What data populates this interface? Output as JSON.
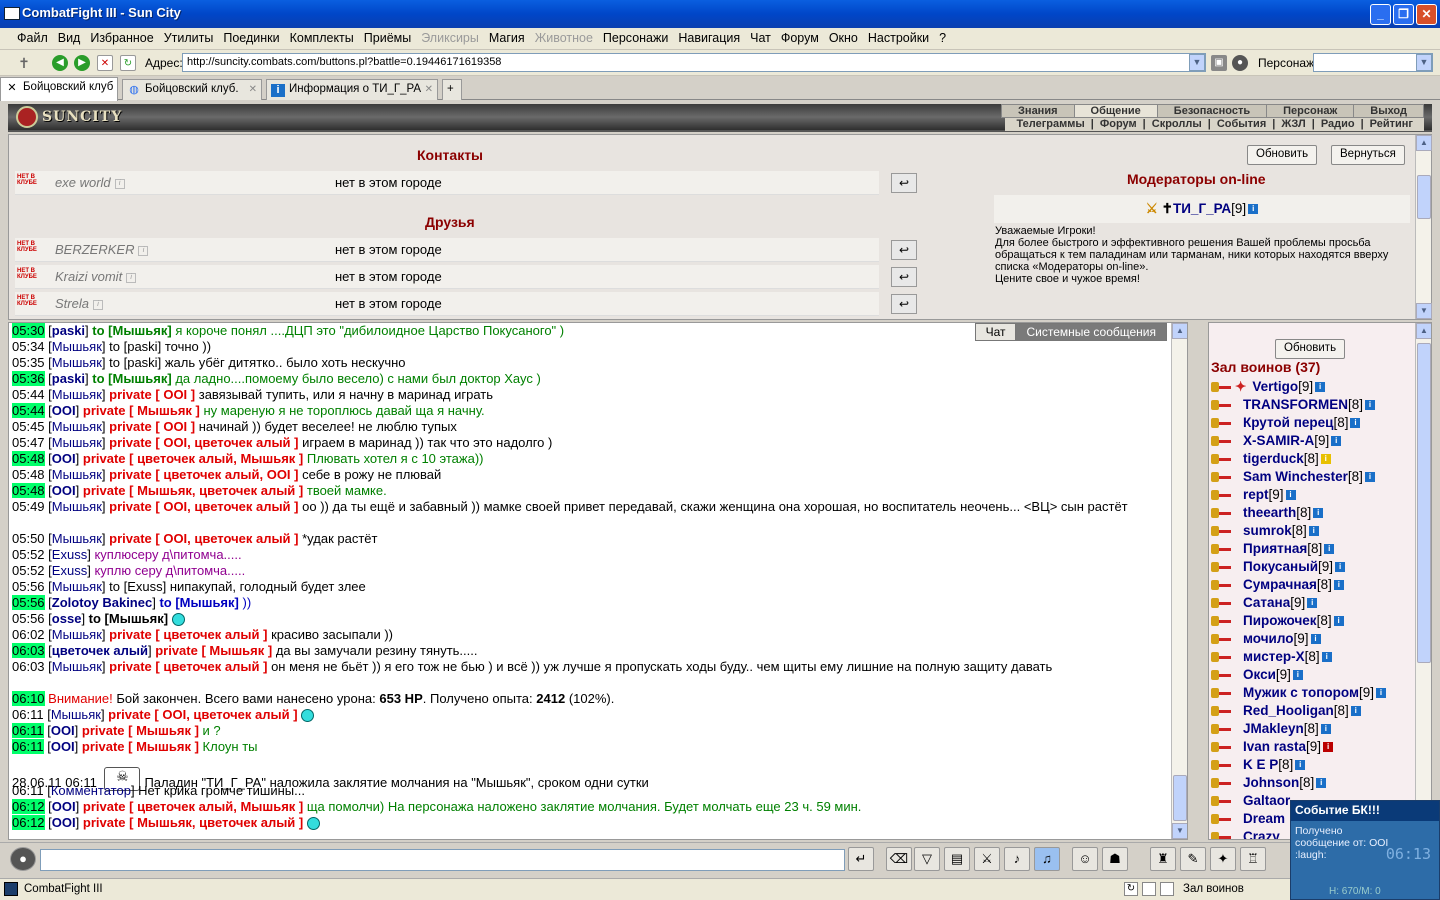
{
  "window": {
    "title": "CombatFight III - Sun City"
  },
  "menu": [
    "Файл",
    "Вид",
    "Избранное",
    "Утилиты",
    "Поединки",
    "Комплекты",
    "Приёмы",
    "Эликсиры",
    "Магия",
    "Животное",
    "Персонажи",
    "Навигация",
    "Чат",
    "Форум",
    "Окно",
    "Настройки",
    "?"
  ],
  "address": {
    "label": "Адрес:",
    "url": "http://suncity.combats.com/buttons.pl?battle=0.19446171619358",
    "persona_label": "Персонаж:"
  },
  "tabs": [
    "Бойцовский клуб",
    "Бойцовский клуб.",
    "Информация о ТИ_Г_РА"
  ],
  "topnav": {
    "main": [
      "Знания",
      "Общение",
      "Безопасность",
      "Персонаж",
      "Выход"
    ],
    "sub": [
      "Телеграммы",
      "Форум",
      "Скроллы",
      "События",
      "ЖЗЛ",
      "Радио",
      "Рейтинг"
    ]
  },
  "logo": "SUNCITY",
  "contacts": {
    "title": "Контакты",
    "friends_title": "Друзья",
    "not_in_club": "НЕТ В КЛУБЕ",
    "contacts": [
      {
        "name": "exe world",
        "status": "нет в этом городе"
      }
    ],
    "friends": [
      {
        "name": "BERZERKER",
        "status": "нет в этом городе"
      },
      {
        "name": "Kraizi vomit",
        "status": "нет в этом городе"
      },
      {
        "name": "Strela",
        "status": "нет в этом городе"
      }
    ],
    "refresh": "Обновить",
    "back": "Вернуться",
    "moderators_title": "Модераторы on-line",
    "moderator": "ТИ_Г_РА",
    "moderator_level": "[9]",
    "moderator_text": "Уважаемые Игроки!\nДля более быстрого и эффективного решения Вашей проблемы просьба обращаться к тем паладинам или тарманам, ники которых находятся вверху списка «Модераторы on-line».\nЦените свое и чужое время!"
  },
  "chat_tabs": [
    "Чат",
    "Системные сообщения"
  ],
  "chat": [
    {
      "t": "05:30",
      "h": true,
      "who": "paski",
      "type": "to",
      "tgt": "Мышьяк",
      "msg": "я короче понял ....ДЦП это \"дибилоидное Царство Покусаного\" )",
      "c": "tg"
    },
    {
      "t": "05:34",
      "who": "Мышьяк",
      "type": "to",
      "tgt": "paski",
      "msg": "точно ))",
      "c": ""
    },
    {
      "t": "05:35",
      "who": "Мышьяк",
      "type": "to",
      "tgt": "paski",
      "msg": "жаль убёг дитятко.. было хоть нескучно",
      "c": ""
    },
    {
      "t": "05:36",
      "h": true,
      "who": "paski",
      "type": "to",
      "tgt": "Мышьяк",
      "msg": "да ладно....помоему было весело) с нами был доктор Хаус )",
      "c": "tg"
    },
    {
      "t": "05:44",
      "who": "Мышьяк",
      "type": "private",
      "tgt": "OOI",
      "msg": "завязывай тупить, или я начну в маринад играть",
      "c": ""
    },
    {
      "t": "05:44",
      "h": true,
      "who": "OOI",
      "type": "private",
      "tgt": "Мышьяк",
      "msg": "ну мареную я не тороплюсь давай ща я начну.",
      "c": "tg"
    },
    {
      "t": "05:45",
      "who": "Мышьяк",
      "type": "private",
      "tgt": "OOI",
      "msg": "начинай )) будет веселее! не люблю тупых",
      "c": ""
    },
    {
      "t": "05:47",
      "who": "Мышьяк",
      "type": "private",
      "tgt": "OOI, цветочек алый",
      "msg": "играем в маринад )) так что это надолго )",
      "c": ""
    },
    {
      "t": "05:48",
      "h": true,
      "who": "OOI",
      "type": "private",
      "tgt": "цветочек алый, Мышьяк",
      "msg": "Плювать хотел я с 10 этажа))",
      "c": "tg"
    },
    {
      "t": "05:48",
      "who": "Мышьяк",
      "type": "private",
      "tgt": "цветочек алый, OOI",
      "msg": "себе в рожу не плювай",
      "c": ""
    },
    {
      "t": "05:48",
      "h": true,
      "who": "OOI",
      "type": "private",
      "tgt": "Мышьяк, цветочек алый",
      "msg": "твоей мамке.",
      "c": "tg"
    },
    {
      "t": "05:49",
      "who": "Мышьяк",
      "type": "private",
      "tgt": "OOI, цветочек алый",
      "msg": "оо )) да ты ещё и забавный )) мамке своей привет передавай, скажи женщина она хорошая, но воспитатель неочень... <ВЦ> сын растёт",
      "c": "",
      "wrap": true
    },
    {
      "t": "05:50",
      "who": "Мышьяк",
      "type": "private",
      "tgt": "OOI, цветочек алый",
      "msg": "*удак растёт",
      "c": ""
    },
    {
      "t": "05:52",
      "who": "Exuss",
      "type": "plain",
      "msg": "куплюсеру д\\питомча.....",
      "c": "pur"
    },
    {
      "t": "05:52",
      "who": "Exuss",
      "type": "plain",
      "msg": "куплю серу д\\питомча.....",
      "c": "pur"
    },
    {
      "t": "05:56",
      "who": "Мышьяк",
      "type": "to",
      "tgt": "Exuss",
      "msg": "нипакупай, голодный будет злее",
      "c": ""
    },
    {
      "t": "05:56",
      "h": true,
      "who": "Zolotoy Bakinec",
      "type": "to",
      "tgt": "Мышьяк",
      "msg": "))",
      "c": "blu"
    },
    {
      "t": "05:56",
      "who": "osse",
      "type": "to",
      "tgt": "Мышьяк",
      "msg": "",
      "c": "",
      "smile": true
    },
    {
      "t": "06:02",
      "who": "Мышьяк",
      "type": "private",
      "tgt": "цветочек алый",
      "msg": "красиво засыпали ))",
      "c": ""
    },
    {
      "t": "06:03",
      "h": true,
      "who": "цветочек алый",
      "type": "private",
      "tgt": "Мышьяк",
      "msg": "да вы замучали резину тянуть.....",
      "c": ""
    },
    {
      "t": "06:03",
      "who": "Мышьяк",
      "type": "private",
      "tgt": "цветочек алый",
      "msg": "он меня не бьёт )) я его тож не бью ) и всё )) уж лучше я пропускать ходы буду.. чем щиты ему лишние на полную защиту давать",
      "c": "",
      "wrap": true
    },
    {
      "t": "06:10",
      "h": true,
      "type": "system",
      "warn": "Внимание!",
      "msg": "Бой закончен. Всего вами нанесено урона:",
      "dmg": "653 HP",
      "msg2": ". Получено опыта:",
      "exp": "2412",
      "msg3": "(102%)."
    },
    {
      "t": "06:11",
      "who": "Мышьяк",
      "type": "private",
      "tgt": "OOI, цветочек алый",
      "msg": "",
      "c": "",
      "smile": true
    },
    {
      "t": "06:11",
      "h": true,
      "who": "OOI",
      "type": "private",
      "tgt": "Мышьяк",
      "msg": "и ?",
      "c": "tg"
    },
    {
      "t": "06:11",
      "h": true,
      "who": "OOI",
      "type": "private",
      "tgt": "Мышьяк",
      "msg": "Клоун ты",
      "c": "tg"
    },
    {
      "t": "28.06.11  06:11",
      "type": "silence",
      "msg": "Паладин \"ТИ_Г_РА\" наложила заклятие молчания на \"Мышьяк\", сроком одни сутки"
    },
    {
      "t": "06:11",
      "who": "Комментатор",
      "type": "plain",
      "msg": "Нет крика громче тишины...",
      "c": ""
    },
    {
      "t": "06:12",
      "h": true,
      "who": "OOI",
      "type": "private",
      "tgt": "цветочек алый, Мышьяк",
      "msg": "ща помолчи) На персонажа наложено заклятие молчания. Будет молчать еще 23 ч. 59 мин.",
      "c": "tg"
    },
    {
      "t": "06:12",
      "h": true,
      "who": "OOI",
      "type": "private",
      "tgt": "Мышьяк, цветочек алый",
      "msg": "",
      "c": "",
      "smile": true
    }
  ],
  "hall": {
    "refresh": "Обновить",
    "title": "Зал воинов (37)",
    "players": [
      {
        "n": "Vertigo",
        "l": "[9]"
      },
      {
        "n": "TRANSFORMEN",
        "l": "[8]"
      },
      {
        "n": "Крутой перец",
        "l": "[8]"
      },
      {
        "n": "X-SAMIR-A",
        "l": "[9]"
      },
      {
        "n": "tigerduck",
        "l": "[8]",
        "y": true
      },
      {
        "n": "Sam Winchester",
        "l": "[8]"
      },
      {
        "n": "rept",
        "l": "[9]"
      },
      {
        "n": "theearth",
        "l": "[8]"
      },
      {
        "n": "sumrok",
        "l": "[8]"
      },
      {
        "n": "Приятная",
        "l": "[8]"
      },
      {
        "n": "Покусаный",
        "l": "[9]"
      },
      {
        "n": "Сумрачная",
        "l": "[8]"
      },
      {
        "n": "Сатана",
        "l": "[9]"
      },
      {
        "n": "Пирожочек",
        "l": "[8]"
      },
      {
        "n": "мочило",
        "l": "[9]"
      },
      {
        "n": "мистер-Х",
        "l": "[8]"
      },
      {
        "n": "Окси",
        "l": "[9]"
      },
      {
        "n": "Мужик с топором",
        "l": "[9]"
      },
      {
        "n": "Red_Hooligan",
        "l": "[8]"
      },
      {
        "n": "JMakleyn",
        "l": "[8]"
      },
      {
        "n": "Ivan rasta",
        "l": "[9]",
        "r": true
      },
      {
        "n": "K E P",
        "l": "[8]"
      },
      {
        "n": "Johnson",
        "l": "[8]"
      },
      {
        "n": "Galtaor",
        "l": ""
      },
      {
        "n": "Dream",
        "l": ""
      },
      {
        "n": "Crazy",
        "l": ""
      }
    ]
  },
  "status": {
    "app": "CombatFight III",
    "hall": "Зал воинов"
  },
  "popup": {
    "title": "Событие БК!!!",
    "text": "Получено сообщение от: OOI :laugh:",
    "clock": "06:13",
    "hp": "H: 670/M: 0"
  }
}
